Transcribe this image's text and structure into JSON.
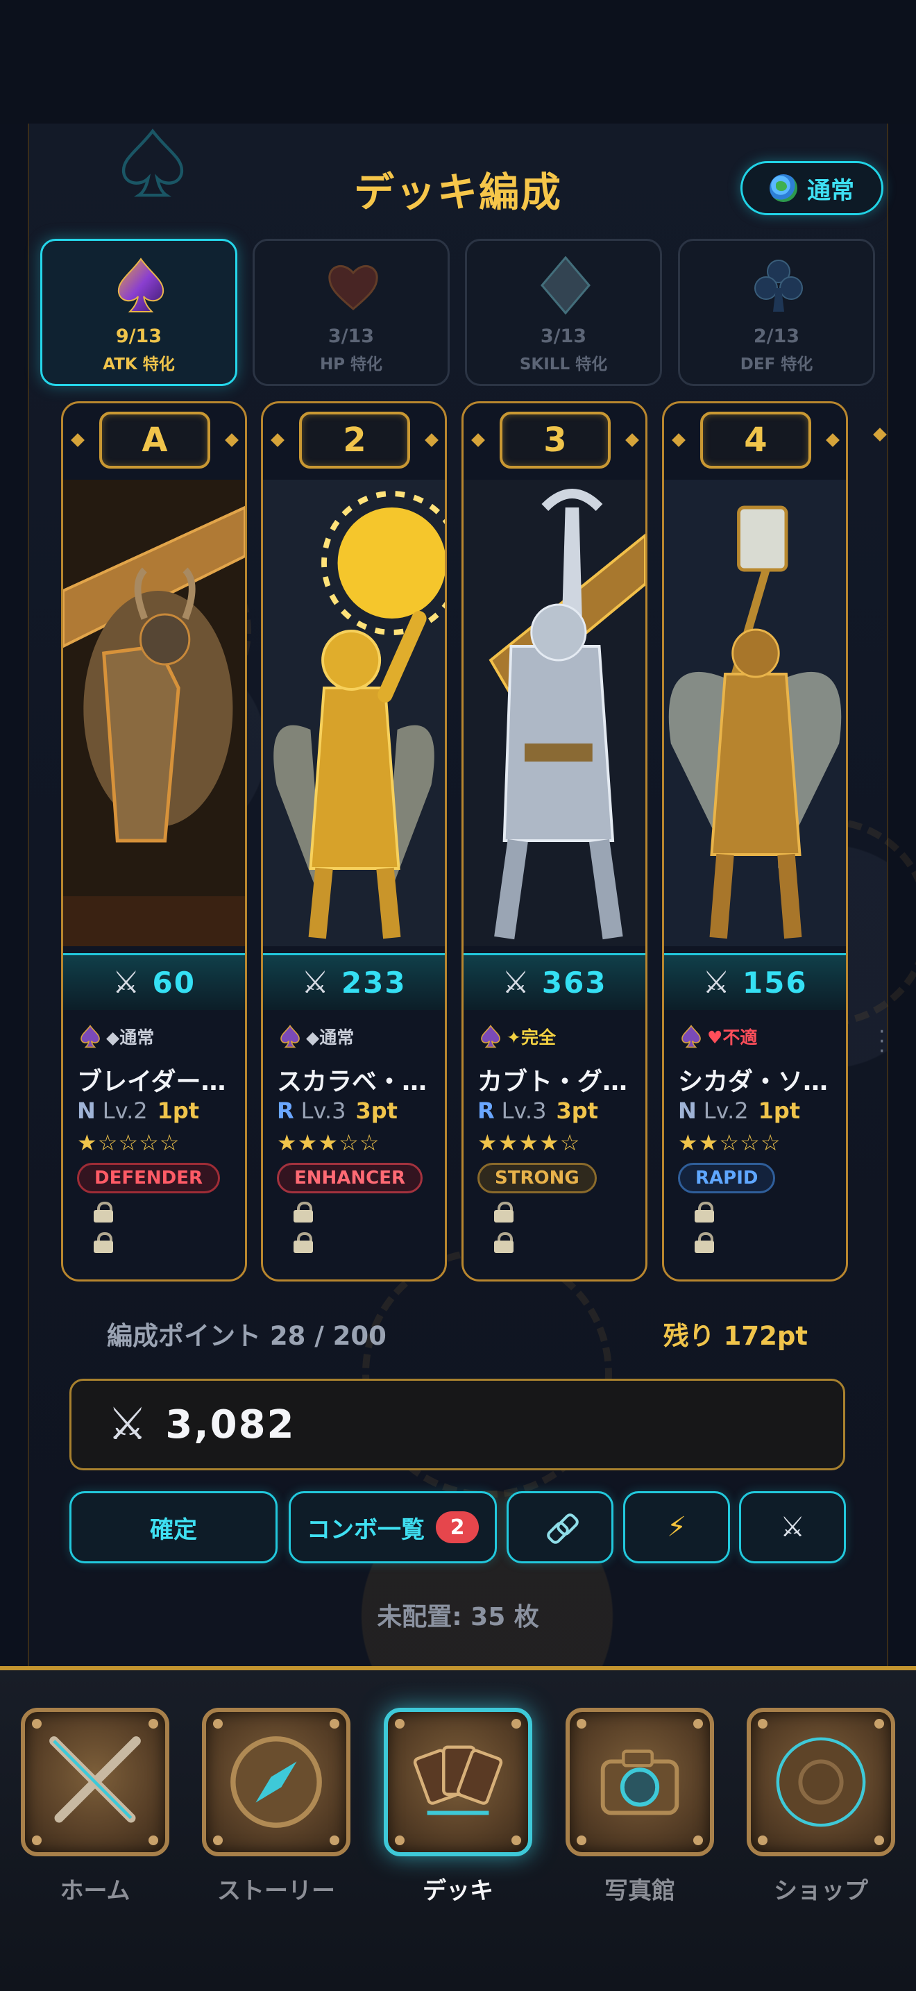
{
  "header": {
    "title": "デッキ編成",
    "mode_label": "通常"
  },
  "suit_tabs": [
    {
      "count": "9/13",
      "label": "ATK 特化",
      "icon": "spade-icon",
      "active": true
    },
    {
      "count": "3/13",
      "label": "HP 特化",
      "icon": "heart-icon",
      "active": false
    },
    {
      "count": "3/13",
      "label": "SKILL 特化",
      "icon": "diamond-icon",
      "active": false
    },
    {
      "count": "2/13",
      "label": "DEF 特化",
      "icon": "club-icon",
      "active": false
    }
  ],
  "cards": [
    {
      "slot": "A",
      "power": "60",
      "attr": "◆通常",
      "attr_type": "normal",
      "name": "ブレイダー…",
      "rarity": "N",
      "level": "Lv.2",
      "points": "1pt",
      "stars": "★☆☆☆☆",
      "role": "DEFENDER"
    },
    {
      "slot": "2",
      "power": "233",
      "attr": "◆通常",
      "attr_type": "normal",
      "name": "スカラベ・…",
      "rarity": "R",
      "level": "Lv.3",
      "points": "3pt",
      "stars": "★★★☆☆",
      "role": "ENHANCER"
    },
    {
      "slot": "3",
      "power": "363",
      "attr": "✦完全",
      "attr_type": "perfect",
      "name": "カブト・グ…",
      "rarity": "R",
      "level": "Lv.3",
      "points": "3pt",
      "stars": "★★★★☆",
      "role": "STRONG"
    },
    {
      "slot": "4",
      "power": "156",
      "attr": "♥不適",
      "attr_type": "bad",
      "name": "シカダ・ソ…",
      "rarity": "N",
      "level": "Lv.2",
      "points": "1pt",
      "stars": "★★☆☆☆",
      "role": "RAPID"
    }
  ],
  "summary": {
    "points_label": "編成ポイント 28 / 200",
    "remaining_label": "残り 172pt",
    "total_power": "3,082"
  },
  "actions": {
    "confirm_label": "確定",
    "combo_label": "コンボ一覧",
    "combo_count": "2"
  },
  "unplaced_label": "未配置: 35 枚",
  "nav": [
    {
      "label": "ホーム",
      "icon": "crossed-swords-icon"
    },
    {
      "label": "ストーリー",
      "icon": "compass-icon"
    },
    {
      "label": "デッキ",
      "icon": "cards-icon",
      "active": true
    },
    {
      "label": "写真館",
      "icon": "camera-icon"
    },
    {
      "label": "ショップ",
      "icon": "shop-emblem-icon"
    }
  ],
  "colors": {
    "accent_cyan": "#22c8dc",
    "gold": "#f0c44b",
    "background": "#0c111d"
  }
}
